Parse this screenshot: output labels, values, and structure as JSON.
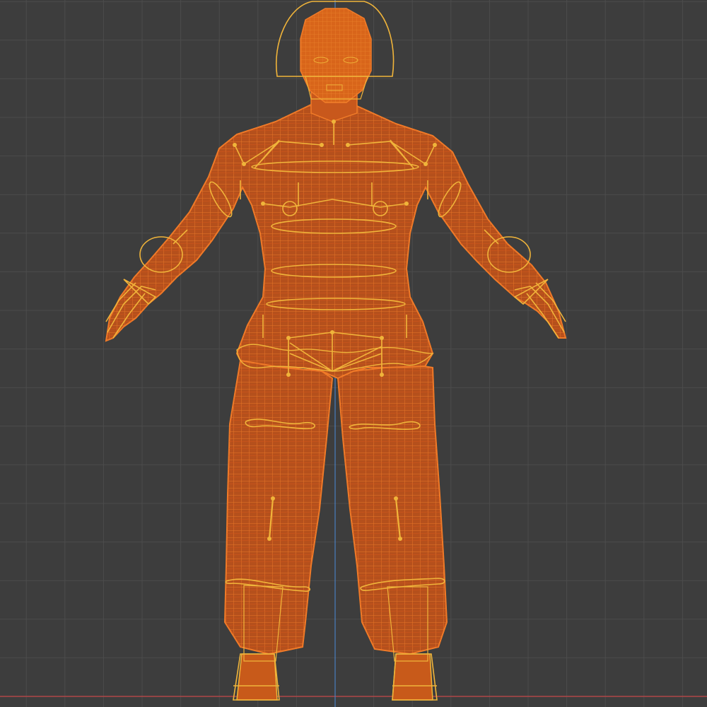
{
  "viewport": {
    "mode": "wireframe",
    "view": "front-orthographic",
    "background_color": "#3d3d3d",
    "grid_color": "#4c4c4c",
    "axis_x_color": "#b04648",
    "axis_z_color": "#4a7fbf"
  },
  "model": {
    "type": "humanoid-mesh-rigged",
    "pose": "A-pose",
    "mesh_color": "#e0661c",
    "mesh_fill_color": "#c9581a",
    "rig_color": "#f0b43a",
    "selected": true
  }
}
